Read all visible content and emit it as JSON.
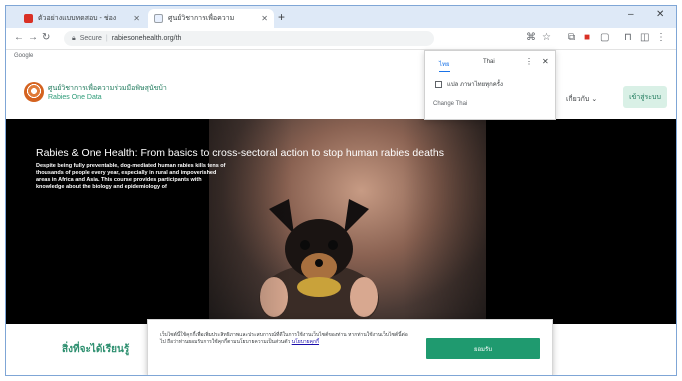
{
  "browser": {
    "tabs": [
      {
        "title": "ตัวอย่างแบบทดสอบ - ช่อง",
        "active": false
      },
      {
        "title": "ศูนย์วิชาการเพื่อความ",
        "active": true
      }
    ],
    "newtab": "+",
    "window_controls": [
      "–",
      "✕"
    ],
    "address": {
      "site_label": "Secure",
      "url": "rabiesonehealth.org/th"
    },
    "bookmarks_label": "Google"
  },
  "translate_popup": {
    "tab_thai": "ไทย",
    "tab_english": "Thai",
    "checkbox_label": "แปล ภาษาไทยทุกครั้ง",
    "lang_label": "Change Thai"
  },
  "site": {
    "brand_line1": "ศูนย์วิชาการเพื่อความร่วมมือพิษสุนัขบ้า",
    "brand_line2": "Rabies One Data",
    "nav_item": "เกี่ยวกับ",
    "login_label": "เข้าสู่ระบบ"
  },
  "hero": {
    "title": "Rabies & One Health: From basics to cross-sectoral action to stop human rabies deaths",
    "description": "Despite being fully preventable, dog-mediated human rabies kills tens of thousands of people every year, especially in rural and impoverished areas in Africa and Asia. This course provides participants with knowledge about the biology and epidemiology of"
  },
  "lower": {
    "heading": "สิ่งที่จะได้เรียนรู้"
  },
  "cookie": {
    "text": "เว็บไซต์นี้ใช้คุกกี้เพื่อเพิ่มประสิทธิภาพและประสบการณ์ที่ดีในการใช้งานเว็บไซต์ของท่าน หากท่านใช้งานเว็บไซต์นี้ต่อไป ถือว่าท่านยอมรับการใช้คุกกี้ตามนโยบายความเป็นส่วนตัว",
    "link": "นโยบายคุกกี้",
    "accept_label": "ยอมรับ"
  }
}
